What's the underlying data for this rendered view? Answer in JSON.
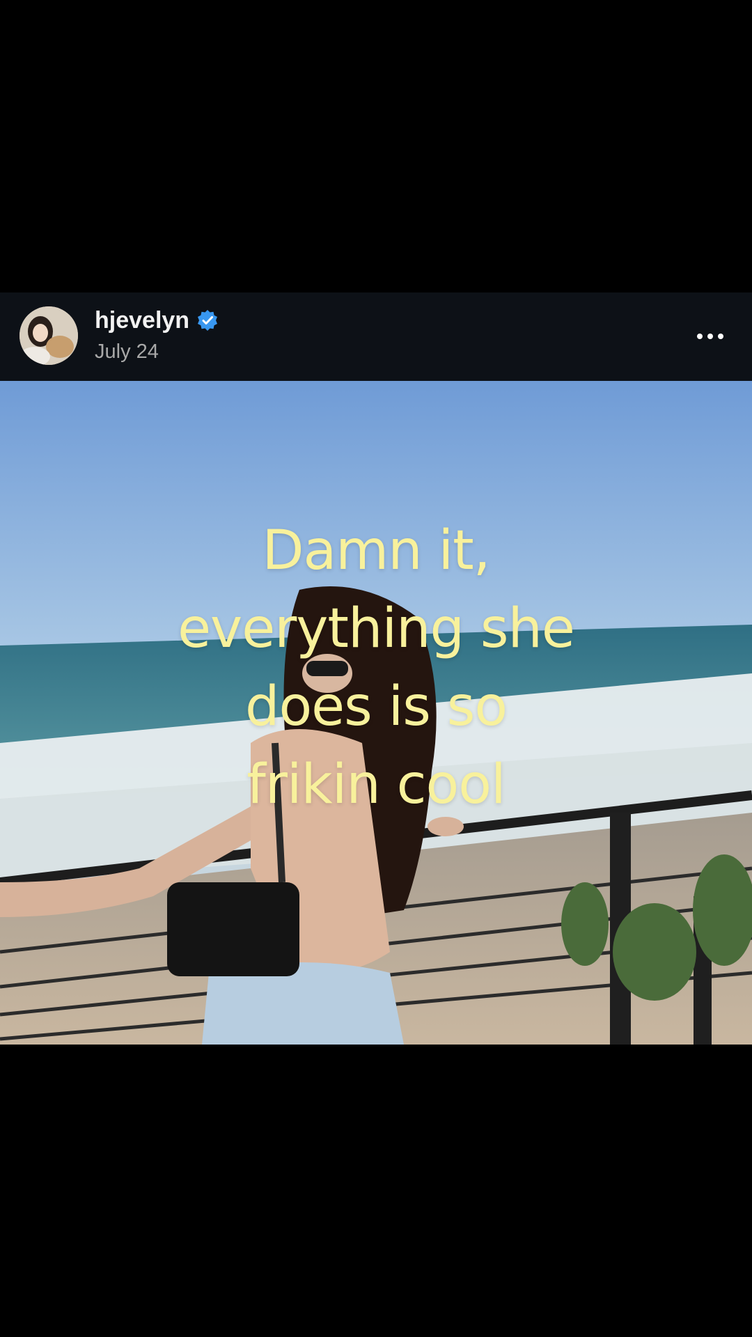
{
  "post": {
    "username": "hjevelyn",
    "date": "July 24",
    "verified_icon": "verified-badge-icon",
    "more_icon": "more-options-icon",
    "accent_color": "#3897f0"
  },
  "overlay": {
    "lines": [
      "Damn it,",
      "everything she",
      "does is so",
      "frikin cool"
    ],
    "text_color": "#f8f19c"
  }
}
